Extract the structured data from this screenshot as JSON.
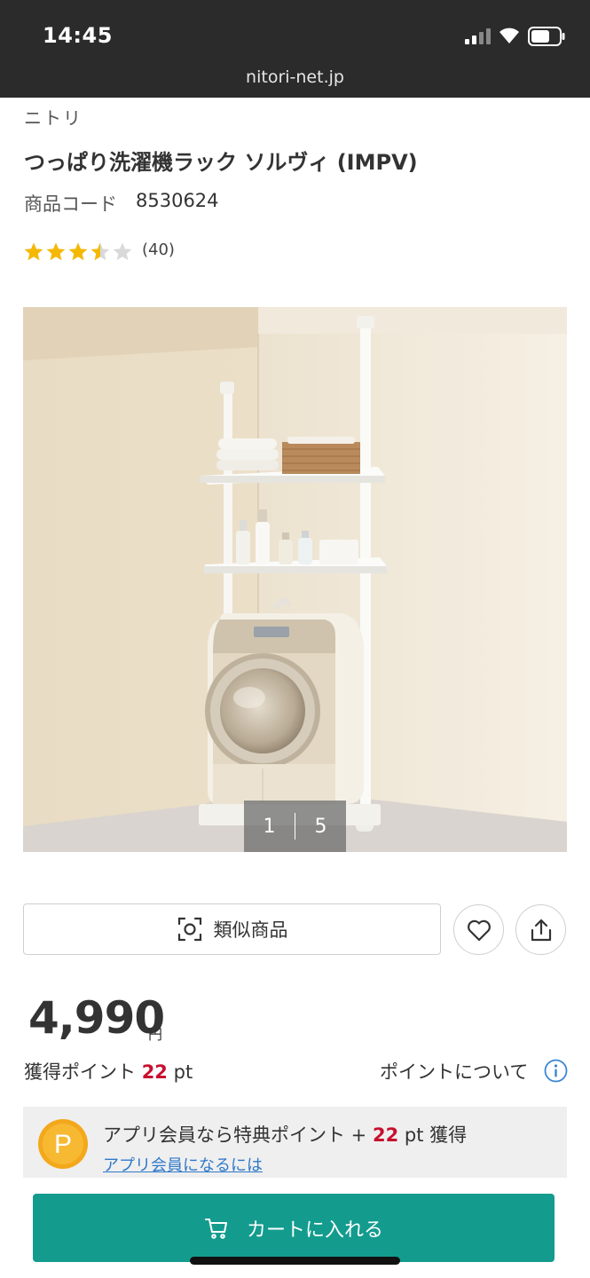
{
  "status_bar": {
    "time": "14:45",
    "url": "nitori-net.jp"
  },
  "product": {
    "brand": "ニトリ",
    "title": "つっぱり洗濯機ラック ソルヴィ (IMPV)",
    "code_label": "商品コード",
    "code_value": "8530624",
    "rating": 3.5,
    "review_count": "(40)"
  },
  "gallery": {
    "current": "1",
    "total": "5"
  },
  "actions": {
    "similar_label": "類似商品",
    "favorite_icon": "heart-icon",
    "share_icon": "share-icon"
  },
  "price": {
    "amount": "4,990",
    "unit": "円"
  },
  "points": {
    "label": "獲得ポイント",
    "value": "22",
    "unit": "pt",
    "about": "ポイントについて"
  },
  "app_banner": {
    "coin_letter": "P",
    "msg_prefix": "アプリ会員なら特典ポイント +",
    "msg_value": "22",
    "msg_suffix": "pt 獲得",
    "link": "アプリ会員になるには"
  },
  "cart": {
    "label": "カートに入れる"
  },
  "colors": {
    "header_bg": "#2b2b2b",
    "accent_red": "#c8102e",
    "cart_teal": "#139c8e",
    "star_gold": "#f5b800",
    "link_blue": "#2f79c9"
  }
}
